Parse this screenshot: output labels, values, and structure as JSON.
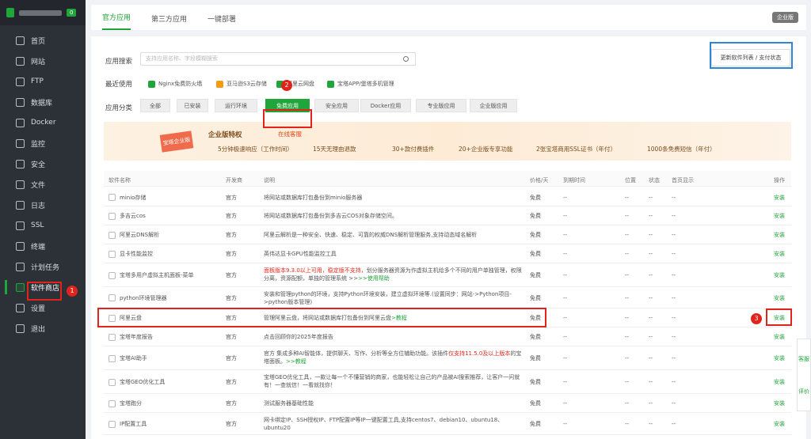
{
  "sidebar": {
    "badge": "0",
    "items": [
      {
        "label": "首页",
        "icon": "home-icon"
      },
      {
        "label": "网站",
        "icon": "website-icon"
      },
      {
        "label": "FTP",
        "icon": "ftp-icon"
      },
      {
        "label": "数据库",
        "icon": "database-icon"
      },
      {
        "label": "Docker",
        "icon": "docker-icon"
      },
      {
        "label": "监控",
        "icon": "monitor-icon"
      },
      {
        "label": "安全",
        "icon": "shield-icon"
      },
      {
        "label": "文件",
        "icon": "folder-icon"
      },
      {
        "label": "日志",
        "icon": "log-icon"
      },
      {
        "label": "SSL",
        "icon": "ssl-icon"
      },
      {
        "label": "终端",
        "icon": "terminal-icon"
      },
      {
        "label": "计划任务",
        "icon": "clock-icon"
      },
      {
        "label": "软件商店",
        "icon": "store-icon"
      },
      {
        "label": "设置",
        "icon": "gear-icon"
      },
      {
        "label": "退出",
        "icon": "logout-icon"
      }
    ]
  },
  "tabs": [
    "官方应用",
    "第三方应用",
    "一键部署"
  ],
  "enterprise_btn": "企业版",
  "search": {
    "label": "应用搜索",
    "placeholder": "支持应用名称、字段模糊搜索"
  },
  "update_btn": "更新软件列表 / 支付状态",
  "recent": {
    "label": "最近使用",
    "items": [
      "Nginx免费防火墙",
      "亚马逊S3云存储",
      "阿里云网盘",
      "宝塔APP/堡塔多机管理"
    ]
  },
  "categories": {
    "label": "应用分类",
    "items": [
      "全部",
      "已安装",
      "运行环境",
      "免费应用",
      "安全应用",
      "Docker应用",
      "专业版应用",
      "企业版应用"
    ]
  },
  "banner": {
    "tag": "宝塔企业版",
    "title": "企业版特权",
    "online": "在线客服",
    "features": [
      "5分钟极速响应（工作时间）",
      "15天无理由退款",
      "30+款付费插件",
      "20+企业版专享功能",
      "2张宝塔商用SSL证书（年付）",
      "1000条免费短信（年付）"
    ]
  },
  "table": {
    "headers": [
      "软件名称",
      "开发商",
      "说明",
      "价格/天",
      "到期时间",
      "位置",
      "状态",
      "首页显示",
      "操作"
    ],
    "rows": [
      {
        "name": "minio存储",
        "dev": "官方",
        "desc": "将网站或数据库打包备份到minio服务器",
        "price": "免费",
        "exp": "--",
        "op": "安装"
      },
      {
        "name": "多吉云cos",
        "dev": "官方",
        "desc": "将网站或数据库打包备份到多吉云COS对象存储空间。",
        "price": "免费",
        "exp": "--",
        "op": "安装"
      },
      {
        "name": "阿里云DNS解析",
        "dev": "官方",
        "desc": "阿里云解析是一种安全、快速、稳定、可靠的权威DNS解析管理服务,支持动态域名解析",
        "price": "免费",
        "exp": "--",
        "op": "安装"
      },
      {
        "name": "显卡性能监控",
        "dev": "官方",
        "desc": "英伟达显卡GPU性能监控工具",
        "price": "免费",
        "exp": "--",
        "op": "安装"
      },
      {
        "name": "宝塔多用户虚拟主机面板-菜单",
        "dev": "官方",
        "desc_red": "面板版本9.3.0以上可用，稳定版不支持，",
        "desc": "划分服务器资源为作虚拟主机给多个不同的用户单独管理，权限分离，资源配额，单独的管理系统 >>",
        "desc_link": ">>使用帮助",
        "price": "免费",
        "exp": "--",
        "op": "安装"
      },
      {
        "name": "python环境管理器",
        "dev": "官方",
        "desc": "安装和管理python的环境，支持Python环境安装，建立虚拟环境等.(设置同步：网站->Python项目->python版本管理)",
        "price": "免费",
        "exp": "--",
        "op": "安装"
      },
      {
        "name": "阿里云盘",
        "dev": "官方",
        "desc": "管理阿里云盘，将网站或数据库打包备份到阿里云盘",
        "desc_link": ">教程",
        "price": "免费",
        "exp": "--",
        "op": "安装"
      },
      {
        "name": "宝塔年度报告",
        "dev": "官方",
        "desc": "点击回顾你的2025年度报告",
        "price": "免费",
        "exp": "--",
        "op": "安装"
      },
      {
        "name": "宝塔AI助手",
        "dev": "官方",
        "desc": "官方 集成多种AI智能体，提供聊天、写作、分析等全方位辅助功能。该插件",
        "desc_red": "仅支持11.5.0及以上版本",
        "desc2": "的宝塔面板。",
        "desc_link": ">>教程",
        "price": "免费",
        "exp": "--",
        "op": "安装"
      },
      {
        "name": "宝塔GEO优化工具",
        "dev": "官方",
        "desc": "宝塔GEO优化工具，一款让每一个不懂营销的商家，也能轻松让自己的产品被AI搜索推荐，让客户一问就有！一查就信！一看就找你！",
        "price": "免费",
        "exp": "--",
        "op": "安装"
      },
      {
        "name": "宝塔跑分",
        "dev": "官方",
        "desc": "测试服务器基础性能",
        "price": "免费",
        "exp": "--",
        "op": "安装"
      },
      {
        "name": "IP配置工具",
        "dev": "官方",
        "desc": "网卡绑定IP、SSH授权IP、FTP配置IP等IP一键配置工具,支持centos7、debian10、ubuntu18、ubuntu20",
        "price": "免费",
        "exp": "--",
        "op": "安装"
      }
    ]
  },
  "markers": [
    "1",
    "2",
    "3"
  ],
  "float": [
    "客服",
    "评价"
  ]
}
